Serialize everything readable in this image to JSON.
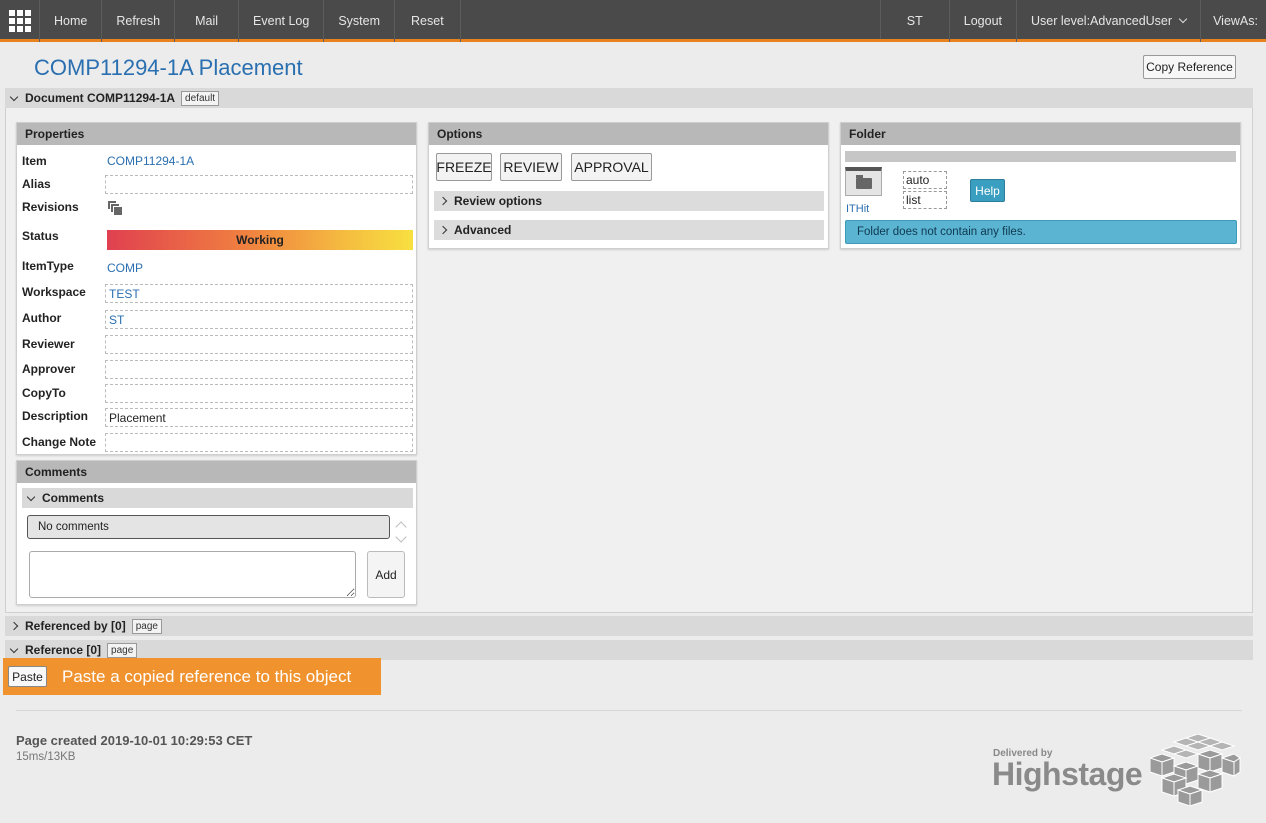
{
  "nav": {
    "items": [
      "Home",
      "Refresh",
      "Mail",
      "Event Log",
      "System",
      "Reset"
    ],
    "user": "ST",
    "logout": "Logout",
    "user_level": "User level:AdvancedUser",
    "view_as": "ViewAs:"
  },
  "header": {
    "title": "COMP11294-1A Placement",
    "copy_reference": "Copy Reference"
  },
  "document_section": {
    "label": "Document COMP11294-1A",
    "tag": "default"
  },
  "properties": {
    "title": "Properties",
    "rows": {
      "item": {
        "label": "Item",
        "value": "COMP11294-1A"
      },
      "alias": {
        "label": "Alias",
        "value": ""
      },
      "revisions": {
        "label": "Revisions"
      },
      "status": {
        "label": "Status",
        "value": "Working"
      },
      "itemtype": {
        "label": "ItemType",
        "value": "COMP"
      },
      "workspace": {
        "label": "Workspace",
        "value": "TEST"
      },
      "author": {
        "label": "Author",
        "value": "ST"
      },
      "reviewer": {
        "label": "Reviewer",
        "value": ""
      },
      "approver": {
        "label": "Approver",
        "value": ""
      },
      "copyto": {
        "label": "CopyTo",
        "value": ""
      },
      "description": {
        "label": "Description",
        "value": "Placement"
      },
      "change_note": {
        "label": "Change Note",
        "value": ""
      }
    }
  },
  "comments": {
    "title": "Comments",
    "sub_title": "Comments",
    "empty_text": "No comments",
    "add_label": "Add"
  },
  "options": {
    "title": "Options",
    "buttons": [
      "FREEZE",
      "REVIEW",
      "APPROVAL"
    ],
    "review_options": "Review options",
    "advanced": "Advanced"
  },
  "folder": {
    "title": "Folder",
    "owner": "ITHit",
    "mode_auto": "auto",
    "mode_list": "list",
    "help": "Help",
    "info": "Folder does not contain any files."
  },
  "referenced_by": {
    "label": "Referenced by [0]",
    "tag": "page"
  },
  "reference": {
    "label": "Reference [0]",
    "tag": "page"
  },
  "paste": {
    "button": "Paste",
    "tooltip": "Paste a copied reference to this object"
  },
  "footer": {
    "page_created": "Page created 2019-10-01 10:29:53 CET",
    "stats": "15ms/13KB",
    "delivered_by": "Delivered by",
    "brand": "Highstage"
  },
  "colors": {
    "accent": "#e8821e",
    "link": "#2a6fb0",
    "info": "#5ab4d2"
  }
}
